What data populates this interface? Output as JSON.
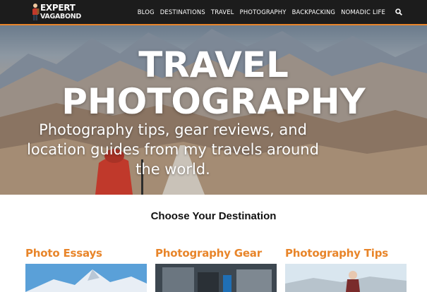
{
  "brand": {
    "line1": "EXPERT",
    "line2": "VAGABOND"
  },
  "nav": {
    "items": [
      {
        "label": "BLOG"
      },
      {
        "label": "DESTINATIONS"
      },
      {
        "label": "TRAVEL"
      },
      {
        "label": "PHOTOGRAPHY"
      },
      {
        "label": "BACKPACKING"
      },
      {
        "label": "NOMADIC LIFE"
      }
    ],
    "search_icon": "search-icon"
  },
  "hero": {
    "title_line1": "TRAVEL",
    "title_line2": "PHOTOGRAPHY",
    "subtitle": "Photography tips, gear reviews, and location guides from my travels around the world."
  },
  "section": {
    "heading": "Choose Your Destination",
    "categories": [
      {
        "title": "Photo Essays"
      },
      {
        "title": "Photography Gear"
      },
      {
        "title": "Photography Tips"
      }
    ]
  },
  "colors": {
    "accent": "#e8852a",
    "nav_bg": "#1c1c1c"
  }
}
